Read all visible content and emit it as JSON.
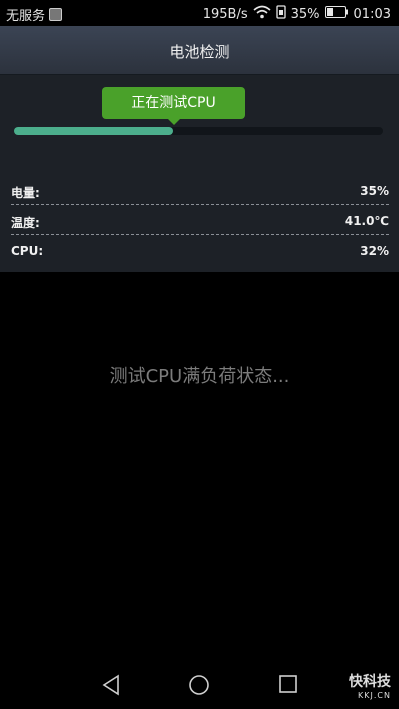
{
  "status_bar": {
    "carrier": "无服务",
    "speed": "195B/s",
    "battery_percent": "35%",
    "time": "01:03"
  },
  "header": {
    "title": "电池检测"
  },
  "test_status": {
    "label": "正在测试CPU",
    "progress": 0.43
  },
  "metrics": [
    {
      "label": "电量:",
      "value": "35%"
    },
    {
      "label": "温度:",
      "value": "41.0℃"
    },
    {
      "label": "CPU:",
      "value": "32%"
    }
  ],
  "main_message": "测试CPU满负荷状态...",
  "watermark": {
    "text": "快科技",
    "sub": "KKJ.CN"
  },
  "colors": {
    "accent": "#4aa12a",
    "progress": "#4cae8c"
  }
}
